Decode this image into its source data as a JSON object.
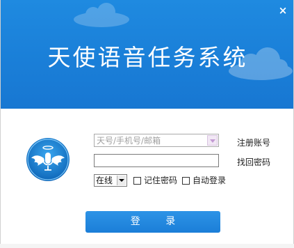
{
  "window": {
    "title": "天使语音任务系统",
    "close_glyph": "×"
  },
  "login": {
    "account_placeholder": "天号/手机号/邮箱",
    "register_link": "注册账号",
    "recover_link": "找回密码",
    "status_value": "在线",
    "remember_label": "记住密码",
    "auto_login_label": "自动登录",
    "login_button": "登  录"
  },
  "colors": {
    "banner": "#1a7fd8",
    "button": "#1b7ed8",
    "text": "#222222"
  },
  "icons": {
    "avatar": "angel-microphone-icon"
  }
}
